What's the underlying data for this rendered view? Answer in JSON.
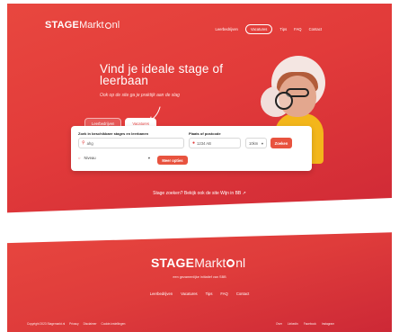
{
  "header": {
    "logo_bold": "STAGE",
    "logo_light": "Markt",
    "logo_tld": "nl",
    "nav": [
      "Leerbedrijven",
      "Vacatures",
      "Tips",
      "FAQ",
      "Contact"
    ]
  },
  "hero": {
    "headline": "Vind je ideale stage of leerbaan",
    "subline": "Ook op de site ga je praktijk aan de slag",
    "tabs": [
      "Leerbedrijven",
      "Vacatures"
    ],
    "search": {
      "label_query": "Zoek in beschikbare stages en leerbanen",
      "query_value": "ahg",
      "label_location": "Plaats of postcode",
      "location_placeholder": "1234 AB",
      "radius_value": "10km",
      "search_button": "Zoeken",
      "filter_label": "Niveau",
      "filter_button": "Meer opties"
    },
    "cta": "Stage zoeken? Bekijk ook de site Wijn in BB"
  },
  "footer": {
    "logo_bold": "STAGE",
    "logo_light": "Markt",
    "logo_tld": "nl",
    "initiative": "een gezamenlijke initiatief van SBB",
    "nav": [
      "Leerbedrijven",
      "Vacatures",
      "Tips",
      "FAQ",
      "Contact"
    ],
    "legal": [
      "Copyright 2023 Stagemarkt.nl",
      "Privacy",
      "Disclaimer",
      "Cookie-instellingen"
    ],
    "social": [
      "Over",
      "Linkedin",
      "Facebook",
      "Instagram"
    ]
  },
  "colors": {
    "brand": "#e23b3a",
    "accent": "#e8533f",
    "photo_shirt": "#f3b61b"
  },
  "icons": {
    "search": "search-icon",
    "location": "location-pin-icon",
    "chevron": "chevron-down-icon"
  }
}
